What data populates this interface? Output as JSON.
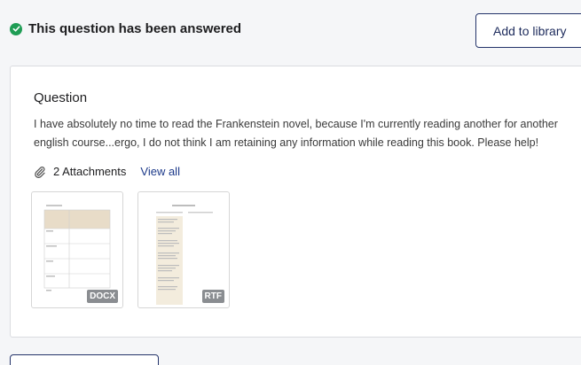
{
  "status": {
    "text": "This question has been answered",
    "color": "#1f9d55"
  },
  "library_button": {
    "label": "Add to library"
  },
  "question": {
    "title": "Question",
    "body": "I have absolutely no time to read the Frankenstein novel, because I'm currently reading another for another english course...ergo, I do not think I am retaining any information while reading this book. Please help!"
  },
  "attachments": {
    "count_label": "2 Attachments",
    "view_all_label": "View all",
    "files": [
      {
        "type": "DOCX"
      },
      {
        "type": "RTF"
      }
    ]
  },
  "colors": {
    "accent": "#1d2b5c",
    "link": "#1d3a8a",
    "badge": "#8a8d91"
  }
}
